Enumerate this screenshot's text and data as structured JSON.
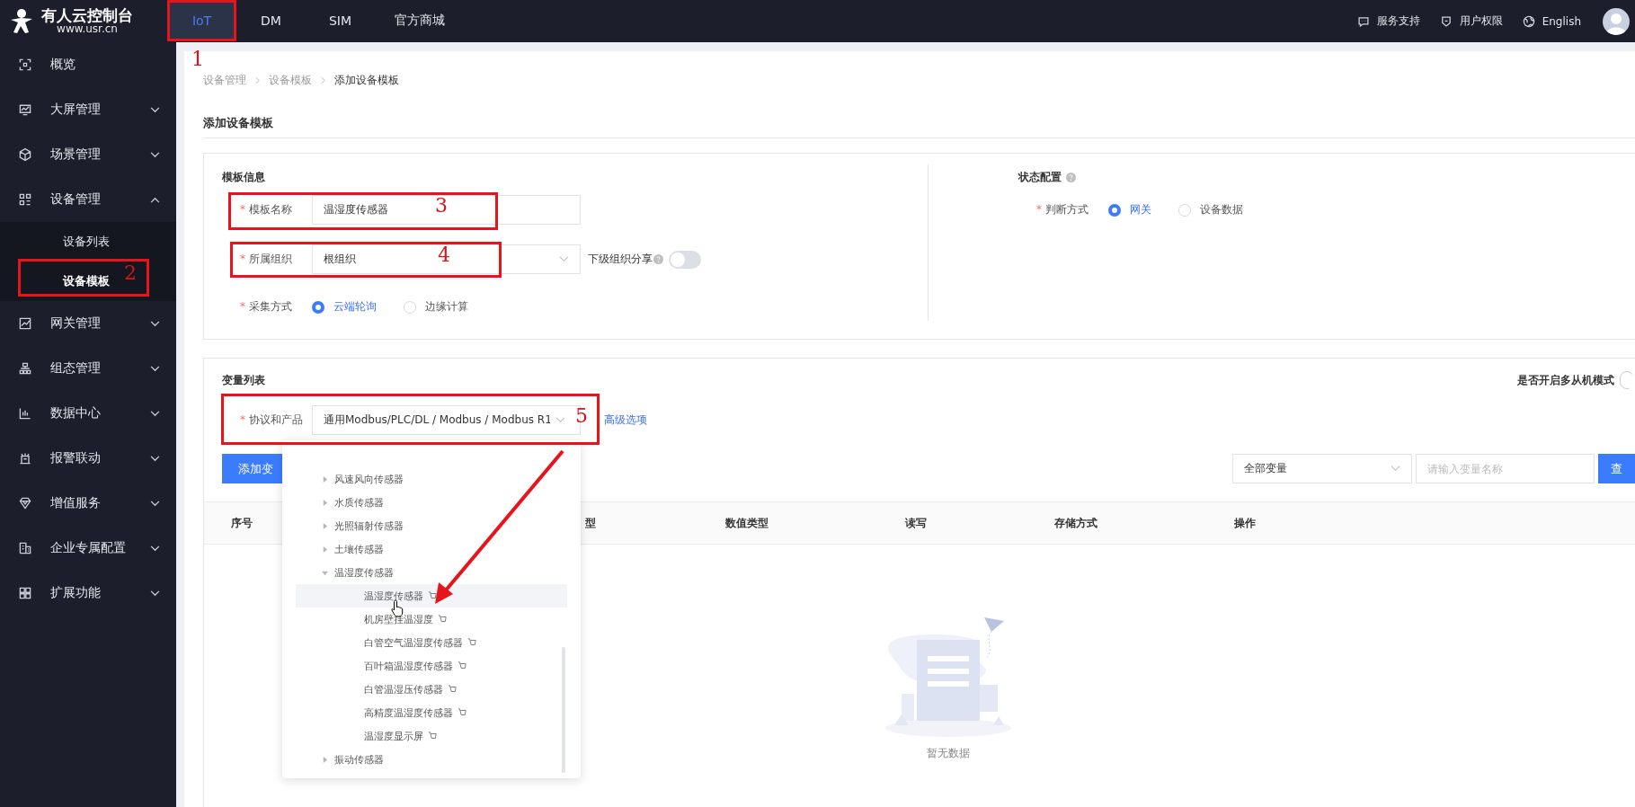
{
  "top_bar": {
    "brand": {
      "name": "有人云控制台",
      "url": "www.usr.cn"
    },
    "tabs": [
      {
        "label": "IoT",
        "selected": true
      },
      {
        "label": "DM",
        "selected": false
      },
      {
        "label": "SIM",
        "selected": false
      },
      {
        "label": "官方商城",
        "selected": false
      }
    ],
    "actions": [
      {
        "kind": "support",
        "label": "服务支持"
      },
      {
        "kind": "permission",
        "label": "用户权限"
      },
      {
        "kind": "language",
        "label": "English"
      }
    ]
  },
  "sidebar": {
    "items": [
      {
        "kind": "overview",
        "label": "概览"
      },
      {
        "kind": "screen",
        "label": "大屏管理",
        "expanded": false
      },
      {
        "kind": "scene",
        "label": "场景管理",
        "expanded": false
      },
      {
        "kind": "device",
        "label": "设备管理",
        "expanded": true,
        "children": [
          {
            "label": "设备列表",
            "selected": false
          },
          {
            "label": "设备模板",
            "selected": true
          }
        ]
      },
      {
        "kind": "gateway",
        "label": "网关管理",
        "expanded": false
      },
      {
        "kind": "topology",
        "label": "组态管理",
        "expanded": false
      },
      {
        "kind": "data",
        "label": "数据中心",
        "expanded": false
      },
      {
        "kind": "alarm",
        "label": "报警联动",
        "expanded": false
      },
      {
        "kind": "value",
        "label": "增值服务",
        "expanded": false
      },
      {
        "kind": "enterprise",
        "label": "企业专属配置",
        "expanded": false
      },
      {
        "kind": "extend",
        "label": "扩展功能",
        "expanded": false
      }
    ]
  },
  "breadcrumb": [
    "设备管理",
    "设备模板",
    "添加设备模板"
  ],
  "page_title": "添加设备模板",
  "template_info": {
    "title": "模板信息",
    "name": {
      "required_mark": "*",
      "label": "模板名称",
      "value": "温湿度传感器"
    },
    "org": {
      "required_mark": "*",
      "label": "所属组织",
      "value": "根组织"
    },
    "share": {
      "label": "下级组织分享",
      "on": false
    },
    "collect": {
      "required_mark": "*",
      "label": "采集方式",
      "options": [
        {
          "label": "云端轮询",
          "selected": true
        },
        {
          "label": "边缘计算",
          "selected": false
        }
      ]
    }
  },
  "status_config": {
    "title": "状态配置",
    "judge": {
      "required_mark": "*",
      "label": "判断方式",
      "options": [
        {
          "label": "网关",
          "selected": true
        },
        {
          "label": "设备数据",
          "selected": false
        }
      ]
    }
  },
  "variables": {
    "title": "变量列表",
    "multi_slave": {
      "label": "是否开启多从机模式",
      "on": false
    },
    "protocol": {
      "required_mark": "*",
      "label": "协议和产品",
      "value": "通用Modbus/PLC/DL / Modbus / Modbus R1"
    },
    "advanced_link": "高级选项",
    "add_button": "添加变",
    "filter_select": "全部变量",
    "search_placeholder": "请输入变量名称",
    "query_button": "查",
    "columns": [
      "序号",
      "型",
      "数值类型",
      "读写",
      "存储方式",
      "操作"
    ],
    "empty_text": "暂无数据"
  },
  "dropdown": {
    "items": [
      {
        "label": "风速风向传感器",
        "expanded": false
      },
      {
        "label": "水质传感器",
        "expanded": false
      },
      {
        "label": "光照辐射传感器",
        "expanded": false
      },
      {
        "label": "土壤传感器",
        "expanded": false
      },
      {
        "label": "温湿度传感器",
        "expanded": true,
        "children": [
          {
            "label": "温湿度传感器",
            "highlighted": true
          },
          {
            "label": "机房壁挂温湿度",
            "highlighted": false
          },
          {
            "label": "白管空气温湿度传感器",
            "highlighted": false
          },
          {
            "label": "百叶箱温湿度传感器",
            "highlighted": false
          },
          {
            "label": "白管温湿压传感器",
            "highlighted": false
          },
          {
            "label": "高精度温湿度传感器",
            "highlighted": false
          },
          {
            "label": "温湿度显示屏",
            "highlighted": false
          }
        ]
      },
      {
        "label": "振动传感器",
        "expanded": false
      }
    ]
  },
  "annotations": [
    "1",
    "2",
    "3",
    "4",
    "5"
  ]
}
